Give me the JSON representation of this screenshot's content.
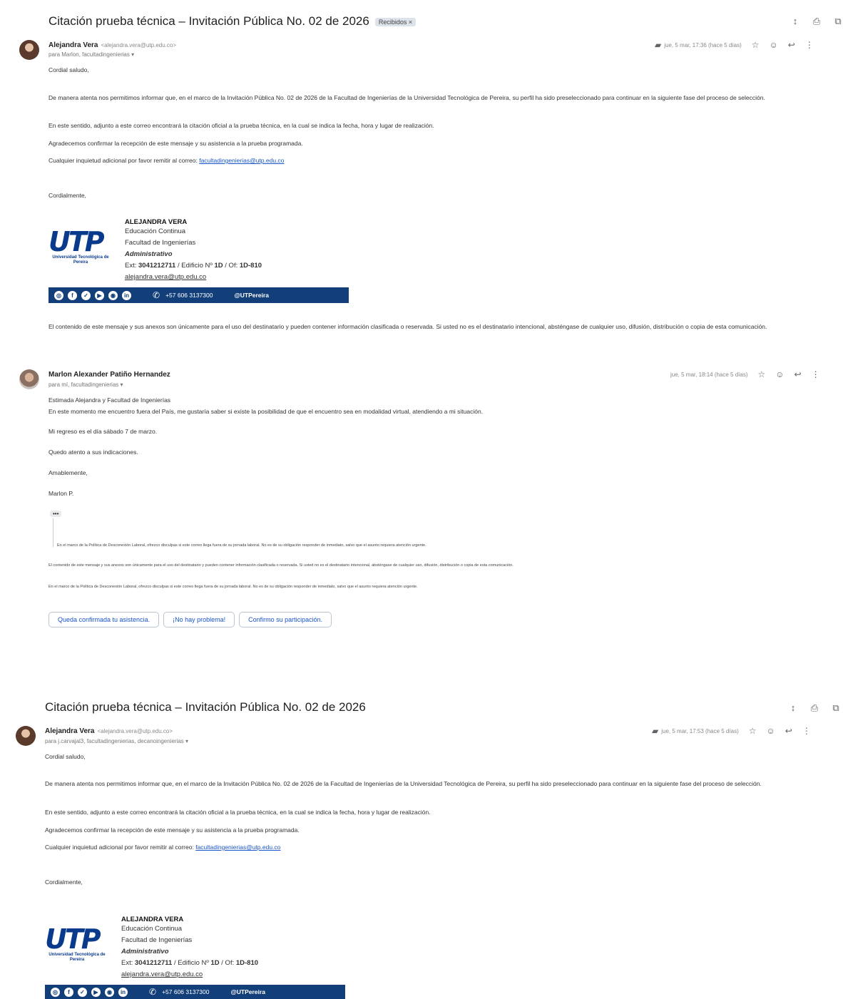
{
  "thread1": {
    "subject": "Citación prueba técnica – Invitación Pública No. 02 de 2026",
    "inbox_chip": "Recibidos ×",
    "msg1": {
      "sender": "Alejandra Vera",
      "sender_email": "<alejandra.vera@utp.edu.co>",
      "to": "para Marlon, facultadingenierias ▾",
      "date": "jue, 5 mar, 17:36 (hace 5 días)",
      "greeting": "Cordial saludo,",
      "p1": "De manera atenta nos permitimos informar que, en el marco de la Invitación Pública No. 02 de 2026 de la Facultad de Ingenierías de la Universidad Tecnológica de Pereira, su perfil ha sido preseleccionado para continuar en la siguiente fase del proceso de selección.",
      "p2": "En este sentido, adjunto a este correo encontrará la citación oficial a la prueba técnica, en la cual se indica la fecha, hora y lugar de realización.",
      "p3": "Agradecemos confirmar la recepción de este mensaje y su asistencia a la prueba programada.",
      "p4": "Cualquier inquietud adicional por favor remitir al correo:",
      "p4_link": "facultadingenierias@utp.edu.co",
      "closing": "Cordialmente,",
      "disclaimer": "El contenido de este mensaje y sus anexos son únicamente para el uso del destinatario y pueden contener información clasificada o reservada. Si usted no es el destinatario intencional, absténgase de cualquier uso, difusión, distribución o copia de esta comunicación."
    },
    "msg2": {
      "sender": "Marlon Alexander Patiño Hernandez",
      "to": "para mí, facultadingenierias ▾",
      "date": "jue, 5 mar, 18:14 (hace 5 días)",
      "l1": "Estimada Alejandra y Facultad de Ingenierías",
      "l2": "En este momento me encuentro fuera del País, me gustaría saber si existe la posibilidad de que el encuentro sea en modalidad virtual, atendiendo a mi situación.",
      "l3": "Mi regreso es el día sábado 7 de marzo.",
      "l4": "Quedo atento a sus indicaciones.",
      "l5": "Amablemente,",
      "l6": "Marlon P.",
      "dots": "•••",
      "quote1": "En el marco de la Política de Desconexión Laboral, ofrezco disculpas si este correo llega fuera de su jornada laboral. No es de su obligación responder de inmediato, salvo que el asunto requiera atención urgente.",
      "quote2": "El contenido de este mensaje y sus anexos son únicamente para el uso del destinatario y pueden contener información clasificada o reservada. Si usted no es el destinatario intencional, absténgase de cualquier uso, difusión, distribución o copia de esta comunicación.",
      "quote3": "En el marco de la Política de Desconexión Laboral, ofrezco disculpas si este correo llega fuera de su jornada laboral. No es de su obligación responder de inmediato, salvo que el asunto requiera atención urgente.",
      "btn1": "Queda confirmada tu asistencia.",
      "btn2": "¡No hay problema!",
      "btn3": "Confirmo su participación."
    }
  },
  "thread2": {
    "subject": "Citación prueba técnica – Invitación Pública No. 02 de 2026",
    "msg": {
      "sender": "Alejandra Vera",
      "sender_email": "<alejandra.vera@utp.edu.co>",
      "to": "para j.carvajal3, facultadingenierias, decanoingenierias ▾",
      "date": "jue, 5 mar, 17:53 (hace 5 días)",
      "greeting": "Cordial saludo,",
      "p1": "De manera atenta nos permitimos informar que, en el marco de la Invitación Pública No. 02 de 2026 de la Facultad de Ingenierías de la Universidad Tecnológica de Pereira, su perfil ha sido preseleccionado para continuar en la siguiente fase del proceso de selección.",
      "p2": "En este sentido, adjunto a este correo encontrará la citación oficial a la prueba técnica, en la cual se indica la fecha, hora y lugar de realización.",
      "p3": "Agradecemos confirmar la recepción de este mensaje y su asistencia a la prueba programada.",
      "p4": "Cualquier inquietud adicional por favor remitir al correo:",
      "p4_link": "facultadingenierias@utp.edu.co",
      "closing": "Cordialmente,"
    }
  },
  "signature": {
    "name": "ALEJANDRA VERA",
    "line1": "Educación Continua",
    "line2": "Facultad de Ingenierías",
    "line3": "Administrativo",
    "ext_prefix": "Ext: ",
    "ext": "3041212711",
    "ext_mid": " / Edificio Nº ",
    "building": "1D",
    "office_prefix": " / Of: ",
    "office": "1D-810",
    "email": "alejandra.vera@utp.edu.co",
    "logo_text": "UTP",
    "logo_sub": "Universidad Tecnológica de Pereira",
    "phone": "+57 606 3137300",
    "handle": "@UTPereira"
  },
  "icons": [
    "expand-icon",
    "print-icon",
    "open-new-window-icon",
    "star-icon",
    "emoji-icon",
    "reply-icon",
    "more-icon",
    "label-icon",
    "phone-icon"
  ]
}
